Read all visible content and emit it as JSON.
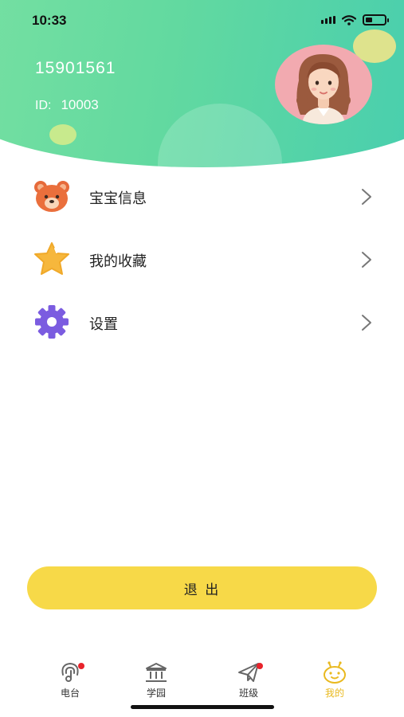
{
  "status_bar": {
    "time": "10:33",
    "battery_level": 0.35
  },
  "profile": {
    "phone": "15901561",
    "id_label": "ID:",
    "id_value": "10003",
    "avatar_icon": "girl-avatar"
  },
  "menu": [
    {
      "label": "宝宝信息",
      "icon": "bear-icon"
    },
    {
      "label": "我的收藏",
      "icon": "star-icon"
    },
    {
      "label": "设置",
      "icon": "gear-icon"
    }
  ],
  "logout_label": "退 出",
  "tabs": [
    {
      "label": "电台",
      "icon": "radio-icon",
      "badge": true,
      "active": false
    },
    {
      "label": "学园",
      "icon": "school-icon",
      "badge": false,
      "active": false
    },
    {
      "label": "班级",
      "icon": "paper-plane-icon",
      "badge": true,
      "active": false
    },
    {
      "label": "我的",
      "icon": "bee-face-icon",
      "badge": false,
      "active": true
    }
  ],
  "colors": {
    "header_start": "#79e1a2",
    "header_end": "#45cdb0",
    "accent_yellow": "#f7d948",
    "active_tab": "#e9b91f",
    "badge_red": "#e8232b"
  }
}
